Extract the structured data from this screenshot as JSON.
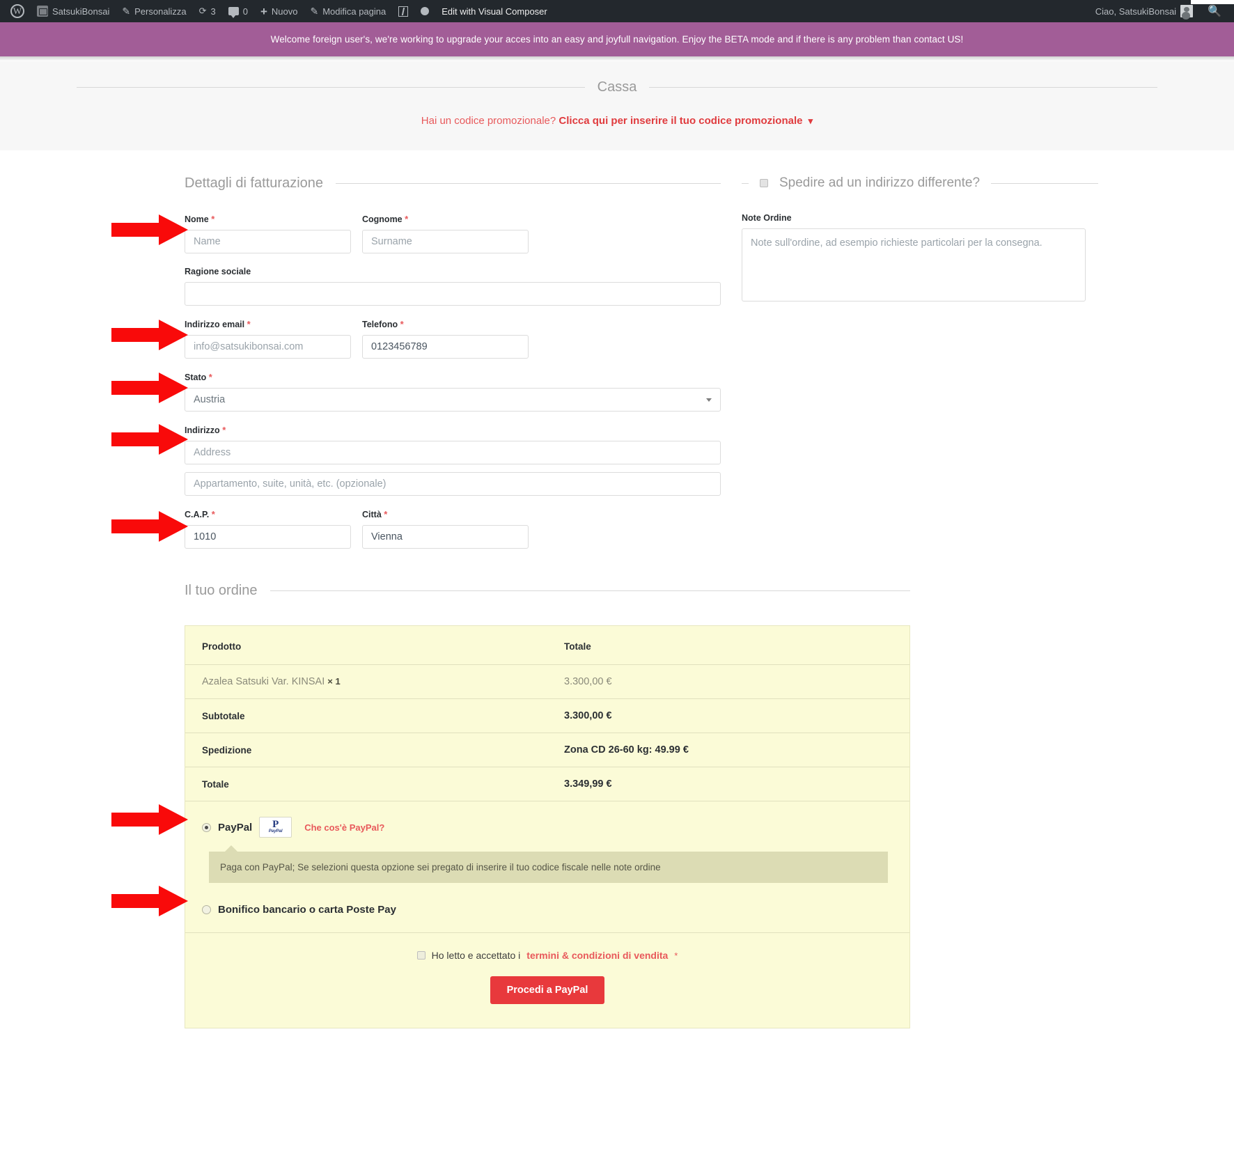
{
  "admin_bar": {
    "items": [
      {
        "name": "wordpress-logo",
        "label": ""
      },
      {
        "name": "site-name",
        "label": "SatsukiBonsai"
      },
      {
        "name": "customize",
        "label": "Personalizza"
      },
      {
        "name": "updates",
        "label": "3"
      },
      {
        "name": "comments",
        "label": "0"
      },
      {
        "name": "new",
        "label": "Nuovo"
      },
      {
        "name": "edit-page",
        "label": "Modifica pagina"
      },
      {
        "name": "visual-composer",
        "label": "Edit with Visual Composer"
      }
    ],
    "site_name": "SatsukiBonsai",
    "customize_label": "Personalizza",
    "updates_count": "3",
    "comments_count": "0",
    "new_label": "Nuovo",
    "edit_page_label": "Modifica pagina",
    "vc_label": "Edit with Visual Composer",
    "greeting": "Ciao, SatsukiBonsai",
    "search_icon": "search-icon"
  },
  "banner": {
    "text": "Welcome foreign user's, we're working to upgrade your acces into an easy and joyfull navigation. Enjoy the BETA mode and if there is any problem than contact US!",
    "background": "#a25d97"
  },
  "page": {
    "title": "Cassa"
  },
  "coupon": {
    "prefix": "Hai un codice promozionale?",
    "link": "Clicca qui per inserire il tuo codice promozionale",
    "chevron": "▾",
    "color": "#e8595b"
  },
  "billing": {
    "heading": "Dettagli di fatturazione",
    "fields": {
      "first_name": {
        "label": "Nome",
        "required": "*",
        "placeholder": "Name",
        "value": ""
      },
      "last_name": {
        "label": "Cognome",
        "required": "*",
        "placeholder": "Surname",
        "value": ""
      },
      "company": {
        "label": "Ragione sociale",
        "required": "",
        "placeholder": "",
        "value": ""
      },
      "email": {
        "label": "Indirizzo email",
        "required": "*",
        "placeholder": "info@satsukibonsai.com",
        "value": ""
      },
      "phone": {
        "label": "Telefono",
        "required": "*",
        "placeholder": "0123456789",
        "value": "0123456789"
      },
      "country": {
        "label": "Stato",
        "required": "*",
        "selected": "Austria"
      },
      "address1": {
        "label": "Indirizzo",
        "required": "*",
        "placeholder": "Address",
        "value": ""
      },
      "address2": {
        "label": "",
        "required": "",
        "placeholder": "Appartamento, suite, unità, etc. (opzionale)",
        "value": ""
      },
      "postcode": {
        "label": "C.A.P.",
        "required": "*",
        "placeholder": "1010",
        "value": "1010"
      },
      "city": {
        "label": "Città",
        "required": "*",
        "placeholder": "Vienna",
        "value": "Vienna"
      }
    }
  },
  "shipping": {
    "toggle_label": "Spedire ad un indirizzo differente?",
    "notes_label": "Note Ordine",
    "notes_placeholder": "Note sull'ordine, ad esempio richieste particolari per la consegna.",
    "notes_value": ""
  },
  "order": {
    "heading": "Il tuo ordine",
    "columns": [
      "Prodotto",
      "Totale"
    ],
    "items": [
      {
        "name": "Azalea Satsuki Var. KINSAI",
        "qty": "× 1",
        "total": "3.300,00 €"
      }
    ],
    "rows": [
      {
        "label": "Subtotale",
        "value": "3.300,00 €"
      },
      {
        "label": "Spedizione",
        "value": "Zona CD 26-60 kg: 49.99 €"
      },
      {
        "label": "Totale",
        "value": "3.349,99 €"
      }
    ],
    "payment_methods": [
      {
        "id": "paypal",
        "label": "PayPal",
        "selected": true,
        "logo": "paypal-logo",
        "help_link": "Che cos'è PayPal?",
        "description": "Paga con PayPal; Se selezioni questa opzione sei pregato di inserire il tuo codice fiscale nelle note ordine"
      },
      {
        "id": "bacs",
        "label": "Bonifico bancario o carta Poste Pay",
        "selected": false
      }
    ],
    "terms": {
      "prefix": "Ho letto e accettato i",
      "link": "termini & condizioni di vendita",
      "required": "*"
    },
    "submit_label": "Procedi a PayPal",
    "submit_color": "#e8393c",
    "box_background": "#fbfbd7"
  },
  "annotations": {
    "arrow_color": "#f90a0a",
    "arrow_count": 7,
    "targets": [
      "nome-field",
      "email-field",
      "stato-select",
      "indirizzo-field",
      "cap-field",
      "paypal-radio",
      "bank-radio"
    ]
  }
}
